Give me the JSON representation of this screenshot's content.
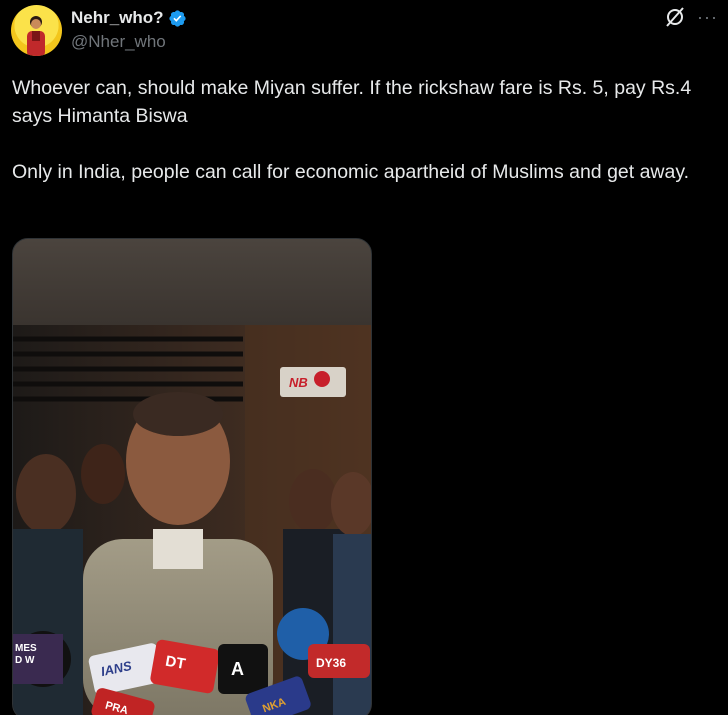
{
  "tweet": {
    "author": {
      "display_name": "Nehr_who?",
      "handle": "@Nher_who",
      "verified": true,
      "avatar_icon": "avatar-image"
    },
    "actions": {
      "grok_icon": "grok-icon",
      "more_icon": "more-icon"
    },
    "text": "Whoever can, should make Miyan suffer. If the rickshaw fare is Rs. 5, pay Rs.4 says Himanta Biswa\n\nOnly in India, people can call for economic apartheid of Muslims and get away.",
    "media": {
      "type": "video-thumbnail",
      "channel_logo_text": "NB",
      "mic_labels": [
        "MES",
        "D W",
        "IANS",
        "DT",
        "DY36",
        "A",
        "NKA",
        "PRA"
      ]
    }
  },
  "colors": {
    "background": "#000000",
    "text_primary": "#e7e9ea",
    "text_secondary": "#71767b",
    "verified_blue": "#1d9bf0"
  }
}
